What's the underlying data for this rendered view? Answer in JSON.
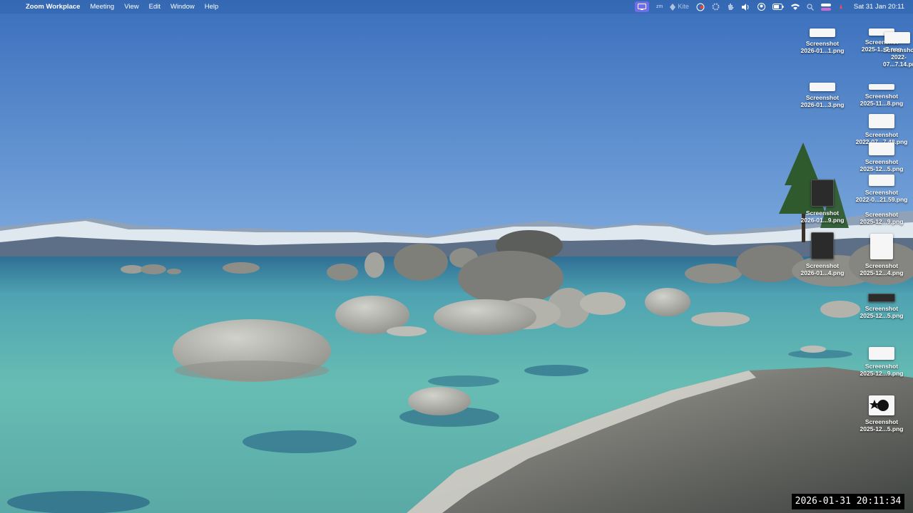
{
  "menubar": {
    "app_name": "Zoom Workplace",
    "menus": [
      "Meeting",
      "View",
      "Edit",
      "Window",
      "Help"
    ],
    "clock": "Sat 31 Jan  20:11",
    "status_icons": [
      "zoom-share-icon",
      "zoom-icon",
      "kite-icon",
      "recording-icon",
      "gear-icon",
      "hand-icon",
      "volume-icon",
      "user-icon",
      "battery-icon",
      "wifi-icon",
      "search-icon",
      "control-center-icon",
      "siri-icon"
    ],
    "kite_label": "Kite",
    "zoom_label": "zm"
  },
  "desktop_icons": [
    {
      "name": "Screenshot",
      "file": "2026-01...1.png"
    },
    {
      "name": "Screenshot",
      "file": "2025-1...7.png"
    },
    {
      "name": "Screenshot",
      "file": "2022-07...7.14.png"
    },
    {
      "name": "Screenshot",
      "file": "2026-01...3.png"
    },
    {
      "name": "Screenshot",
      "file": "2025-11...8.png"
    },
    {
      "name": "Screenshot",
      "file": "2022-07...7.48.png"
    },
    {
      "name": "Screenshot",
      "file": "2025-12...5.png"
    },
    {
      "name": "Screenshot",
      "file": "2022-0...21.59.png"
    },
    {
      "name": "Screenshot",
      "file": "2026-01...9.png"
    },
    {
      "name": "Screenshot",
      "file": "2025-12...9.png"
    },
    {
      "name": "Screenshot",
      "file": "2026-01...4.png"
    },
    {
      "name": "Screenshot",
      "file": "2025-12...4.png"
    },
    {
      "name": "Screenshot",
      "file": "2025-12...5.png"
    },
    {
      "name": "Screenshot",
      "file": "2025-12...9.png"
    },
    {
      "name": "Screenshot",
      "file": "2025-12...5.png"
    }
  ],
  "timestamp_overlay": "2026-01-31  20:11:34",
  "colors": {
    "sky_top": "#3a70bd",
    "sky_bottom": "#6d9fd8",
    "water_teal": "#5fb6b0",
    "water_deep": "#2f6f8e",
    "rock": "#b9b9b3",
    "zoom_highlight": "#6f6ee8"
  }
}
